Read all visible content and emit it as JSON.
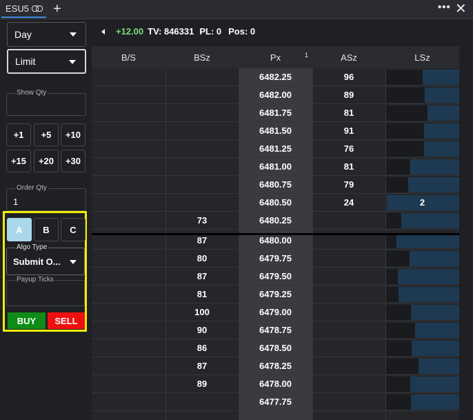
{
  "titlebar": {
    "tab_label": "ESU5",
    "add_label": "+",
    "more_label": "•••",
    "close_label": "✕"
  },
  "left": {
    "duration": "Day",
    "order_type": "Limit",
    "show_qty_label": "Show Qty",
    "qty_buttons": [
      "+1",
      "+5",
      "+10",
      "+15",
      "+20",
      "+30"
    ],
    "order_qty_label": "Order Qty",
    "order_qty_value": "1",
    "abc": [
      "A",
      "B",
      "C"
    ],
    "algo_type_label": "Algo Type",
    "algo_type_value": "Submit O...",
    "payup_label": "Payup Ticks",
    "buy_label": "BUY",
    "sell_label": "SELL"
  },
  "info": {
    "change": "+12.00",
    "tv": "TV: 846331",
    "pl": "PL: 0",
    "pos": "Pos: 0"
  },
  "ladder": {
    "headers": {
      "bs": "B/S",
      "bsz": "BSz",
      "px": "Px",
      "px_sup": "1",
      "asz": "ASz",
      "lsz": "LSz"
    },
    "rows": [
      {
        "bsz": "",
        "px": "6482.25",
        "asz": "96",
        "lsz": "",
        "bar": 0.5
      },
      {
        "bsz": "",
        "px": "6482.00",
        "asz": "89",
        "lsz": "",
        "bar": 0.48
      },
      {
        "bsz": "",
        "px": "6481.75",
        "asz": "81",
        "lsz": "",
        "bar": 0.44
      },
      {
        "bsz": "",
        "px": "6481.50",
        "asz": "91",
        "lsz": "",
        "bar": 0.49
      },
      {
        "bsz": "",
        "px": "6481.25",
        "asz": "76",
        "lsz": "",
        "bar": 0.49
      },
      {
        "bsz": "",
        "px": "6481.00",
        "asz": "81",
        "lsz": "",
        "bar": 0.68
      },
      {
        "bsz": "",
        "px": "6480.75",
        "asz": "79",
        "lsz": "",
        "bar": 0.7
      },
      {
        "bsz": "",
        "px": "6480.50",
        "asz": "24",
        "lsz": "2",
        "bar": 1.0
      },
      {
        "bsz": "73",
        "px": "6480.25",
        "asz": "",
        "lsz": "",
        "bar": 0.8
      },
      {
        "bsz": "87",
        "px": "6480.00",
        "asz": "",
        "lsz": "",
        "bar": 0.87
      },
      {
        "bsz": "80",
        "px": "6479.75",
        "asz": "",
        "lsz": "",
        "bar": 0.69
      },
      {
        "bsz": "87",
        "px": "6479.50",
        "asz": "",
        "lsz": "",
        "bar": 0.85
      },
      {
        "bsz": "81",
        "px": "6479.25",
        "asz": "",
        "lsz": "",
        "bar": 0.84
      },
      {
        "bsz": "100",
        "px": "6479.00",
        "asz": "",
        "lsz": "",
        "bar": 0.67
      },
      {
        "bsz": "90",
        "px": "6478.75",
        "asz": "",
        "lsz": "",
        "bar": 0.61
      },
      {
        "bsz": "86",
        "px": "6478.50",
        "asz": "",
        "lsz": "",
        "bar": 0.66
      },
      {
        "bsz": "87",
        "px": "6478.25",
        "asz": "",
        "lsz": "",
        "bar": 0.56
      },
      {
        "bsz": "89",
        "px": "6478.00",
        "asz": "",
        "lsz": "",
        "bar": 0.68
      },
      {
        "bsz": "",
        "px": "6477.75",
        "asz": "",
        "lsz": "",
        "bar": 0.67
      }
    ]
  },
  "colors": {
    "accent_tab": "#3a8be0",
    "buy": "#0e8c17",
    "sell": "#ee1010",
    "highlight": "#f4ee05",
    "change": "#7cdb7c",
    "lsz_bar": "#1e3a52"
  }
}
